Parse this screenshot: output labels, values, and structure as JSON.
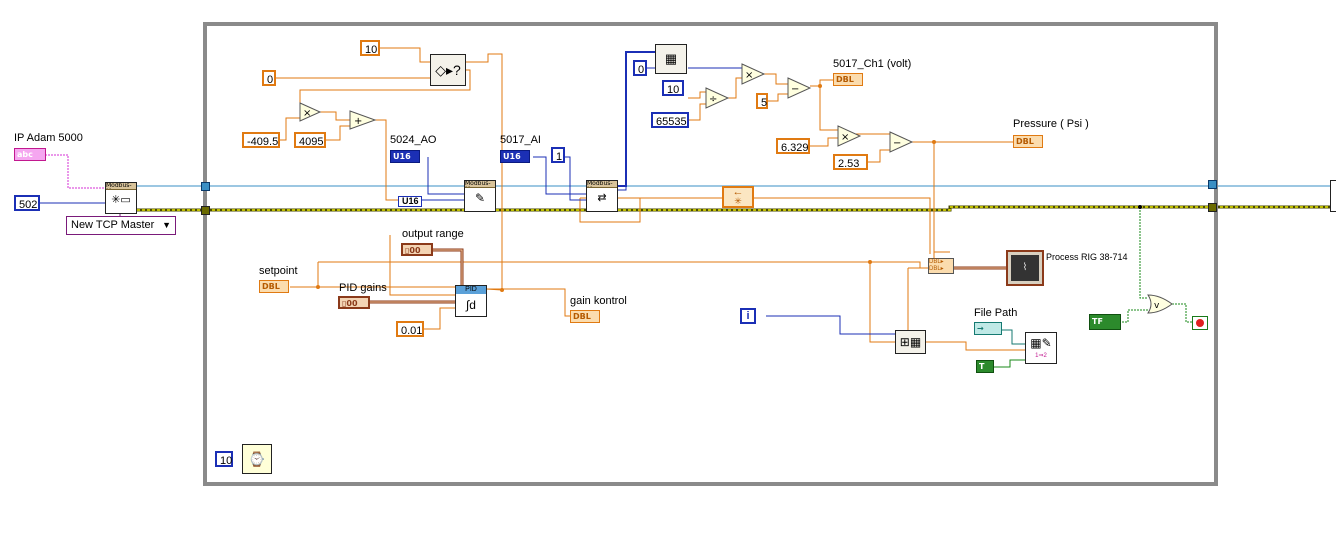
{
  "labels": {
    "ip_adam": "IP Adam 5000",
    "ao_5024": "5024_AO",
    "ai_5017": "5017_AI",
    "ch1_volt": "5017_Ch1 (volt)",
    "pressure": "Pressure ( Psi )",
    "output_range": "output range",
    "setpoint": "setpoint",
    "pid_gains": "PID gains",
    "gain_kontrol": "gain kontrol",
    "process_rig": "Process RIG 38-714",
    "file_path": "File Path"
  },
  "constants": {
    "c_10_top": "10",
    "c_0": "0",
    "c_neg409": "-409.5",
    "c_4095": "4095",
    "c_502": "502",
    "c_1": "1",
    "c_0_array": "0",
    "c_10_div": "10",
    "c_65535": "65535",
    "c_5": "5",
    "c_6329": "6.329",
    "c_253": "2.53",
    "c_001": "0.01",
    "c_10_wait": "10",
    "c_u16": "U16"
  },
  "dropdown": {
    "value": "New TCP Master"
  },
  "terminals": {
    "dbl": "DBL",
    "u16": "U16",
    "abc": "abc",
    "cluster": "▯00",
    "tf": "TF",
    "t": "T",
    "path": "→"
  },
  "vi_headers": {
    "modbus": "Modbus-M",
    "pid": "PID"
  },
  "icons": {
    "iteration": "i",
    "multiply": "×",
    "add": "+",
    "subtract": "−",
    "divide": "÷",
    "or": "v"
  },
  "colors": {
    "double_wire": "#e07a12",
    "integer_wire": "#1b2fb5",
    "string_wire": "#d62fd6",
    "error_wire": "#b8b800",
    "cluster_wire": "#8b3a1a",
    "bool_wire": "#1a8a1a",
    "refnum_wire": "#3a8fc4",
    "frame": "#8a8a8a"
  }
}
